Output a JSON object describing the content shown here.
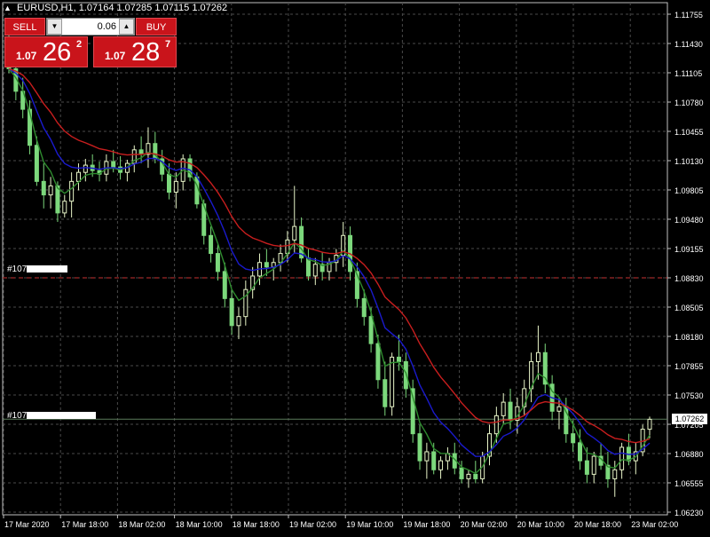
{
  "header": {
    "symbol_tf": "EURUSD,H1",
    "ohlc": "1.07164 1.07285 1.07115 1.07262"
  },
  "trade_panel": {
    "sell_label": "SELL",
    "buy_label": "BUY",
    "lot_value": "0.06",
    "sell_big": "1.07",
    "sell_pips": "26",
    "sell_frac": "2",
    "buy_big": "1.07",
    "buy_pips": "28",
    "buy_frac": "7"
  },
  "order_lines": [
    {
      "label": "#107",
      "price": 1.0883,
      "color": "#c83232",
      "style": "dashed"
    },
    {
      "label": "#107",
      "price": 1.07262,
      "color": "#5a7a5a",
      "style": "solid"
    }
  ],
  "current_price_tag": "1.07262",
  "colors": {
    "bull_candle": "#e8f5c8",
    "bear_candle": "#7cd87c",
    "ma_fast": "#2e8b2e",
    "ma_mid": "#1a1acc",
    "ma_slow": "#c81e1e",
    "grid": "#4a4a4a",
    "accent_red": "#c9141b"
  },
  "chart_data": {
    "type": "candlestick",
    "y_ticks": [
      "1.11755",
      "1.11430",
      "1.11105",
      "1.10780",
      "1.10455",
      "1.10130",
      "1.09805",
      "1.09480",
      "1.09155",
      "1.08830",
      "1.08505",
      "1.08180",
      "1.07855",
      "1.07530",
      "1.07205",
      "1.06880",
      "1.06555",
      "1.06230"
    ],
    "ylim": [
      1.0623,
      1.11755
    ],
    "x_ticks": [
      "17 Mar 2020",
      "17 Mar 18:00",
      "18 Mar 02:00",
      "18 Mar 10:00",
      "18 Mar 18:00",
      "19 Mar 02:00",
      "19 Mar 10:00",
      "19 Mar 18:00",
      "20 Mar 02:00",
      "20 Mar 10:00",
      "20 Mar 18:00",
      "23 Mar 02:00"
    ],
    "candles": [
      [
        1.114,
        1.1165,
        1.111,
        1.1115
      ],
      [
        1.1115,
        1.114,
        1.108,
        1.109
      ],
      [
        1.109,
        1.1105,
        1.106,
        1.107
      ],
      [
        1.107,
        1.108,
        1.102,
        1.103
      ],
      [
        1.103,
        1.104,
        1.0985,
        1.099
      ],
      [
        1.099,
        1.101,
        1.096,
        1.0975
      ],
      [
        1.0975,
        1.0995,
        1.096,
        1.0985
      ],
      [
        1.0985,
        1.099,
        1.0945,
        1.0955
      ],
      [
        1.0955,
        1.0975,
        1.095,
        1.0968
      ],
      [
        1.0968,
        1.1,
        1.095,
        1.099
      ],
      [
        1.099,
        1.101,
        1.098,
        1.1
      ],
      [
        1.1,
        1.1015,
        1.099,
        1.1008
      ],
      [
        1.1008,
        1.102,
        1.0995,
        1.1002
      ],
      [
        1.1002,
        1.1012,
        1.099,
        1.0998
      ],
      [
        1.0998,
        1.102,
        1.099,
        1.1012
      ],
      [
        1.1012,
        1.1025,
        1.1,
        1.1006
      ],
      [
        1.1006,
        1.1018,
        1.0992,
        1.1
      ],
      [
        1.1,
        1.1014,
        1.099,
        1.101
      ],
      [
        1.101,
        1.103,
        1.1,
        1.1025
      ],
      [
        1.1025,
        1.104,
        1.101,
        1.102
      ],
      [
        1.102,
        1.105,
        1.1005,
        1.1032
      ],
      [
        1.1032,
        1.1045,
        1.101,
        1.1015
      ],
      [
        1.1015,
        1.1025,
        1.099,
        1.0998
      ],
      [
        1.0998,
        1.101,
        1.097,
        1.0978
      ],
      [
        1.0978,
        1.1,
        1.096,
        1.099
      ],
      [
        1.099,
        1.102,
        1.098,
        1.1015
      ],
      [
        1.1015,
        1.102,
        1.099,
        1.0995
      ],
      [
        1.0995,
        1.1,
        1.096,
        1.0965
      ],
      [
        1.0965,
        1.097,
        1.092,
        1.093
      ],
      [
        1.093,
        1.094,
        1.09,
        1.091
      ],
      [
        1.091,
        1.092,
        1.088,
        1.089
      ],
      [
        1.089,
        1.09,
        1.085,
        1.086
      ],
      [
        1.086,
        1.087,
        1.082,
        1.083
      ],
      [
        1.083,
        1.085,
        1.0815,
        1.084
      ],
      [
        1.084,
        1.088,
        1.083,
        1.087
      ],
      [
        1.087,
        1.0895,
        1.086,
        1.0885
      ],
      [
        1.0885,
        1.091,
        1.0875,
        1.09
      ],
      [
        1.09,
        1.0915,
        1.0885,
        1.0895
      ],
      [
        1.0895,
        1.0905,
        1.088,
        1.09
      ],
      [
        1.09,
        1.092,
        1.089,
        1.091
      ],
      [
        1.091,
        1.0935,
        1.09,
        1.0925
      ],
      [
        1.0925,
        1.0985,
        1.091,
        1.094
      ],
      [
        1.094,
        1.095,
        1.09,
        1.0905
      ],
      [
        1.0905,
        1.0915,
        1.088,
        1.0885
      ],
      [
        1.0885,
        1.0905,
        1.0875,
        1.0898
      ],
      [
        1.0898,
        1.0912,
        1.088,
        1.089
      ],
      [
        1.089,
        1.0905,
        1.088,
        1.09
      ],
      [
        1.09,
        1.0915,
        1.089,
        1.0908
      ],
      [
        1.0908,
        1.0945,
        1.0895,
        1.093
      ],
      [
        1.093,
        1.094,
        1.088,
        1.089
      ],
      [
        1.089,
        1.09,
        1.085,
        1.086
      ],
      [
        1.086,
        1.087,
        1.083,
        1.084
      ],
      [
        1.084,
        1.085,
        1.08,
        1.081
      ],
      [
        1.081,
        1.082,
        1.076,
        1.077
      ],
      [
        1.077,
        1.079,
        1.073,
        1.074
      ],
      [
        1.074,
        1.08,
        1.073,
        1.0795
      ],
      [
        1.0795,
        1.082,
        1.078,
        1.079
      ],
      [
        1.079,
        1.08,
        1.075,
        1.076
      ],
      [
        1.076,
        1.077,
        1.07,
        1.071
      ],
      [
        1.071,
        1.072,
        1.067,
        1.068
      ],
      [
        1.068,
        1.07,
        1.066,
        1.069
      ],
      [
        1.069,
        1.07,
        1.0665,
        1.067
      ],
      [
        1.067,
        1.0685,
        1.066,
        1.068
      ],
      [
        1.068,
        1.0695,
        1.067,
        1.0688
      ],
      [
        1.0688,
        1.07,
        1.0665,
        1.0672
      ],
      [
        1.0672,
        1.068,
        1.0655,
        1.066
      ],
      [
        1.066,
        1.067,
        1.065,
        1.0665
      ],
      [
        1.0665,
        1.068,
        1.0655,
        1.066
      ],
      [
        1.066,
        1.069,
        1.0655,
        1.0685
      ],
      [
        1.0685,
        1.072,
        1.0675,
        1.071
      ],
      [
        1.071,
        1.074,
        1.07,
        1.073
      ],
      [
        1.073,
        1.0755,
        1.072,
        1.0745
      ],
      [
        1.0745,
        1.076,
        1.0715,
        1.0725
      ],
      [
        1.0725,
        1.075,
        1.071,
        1.074
      ],
      [
        1.074,
        1.077,
        1.073,
        1.076
      ],
      [
        1.076,
        1.08,
        1.0745,
        1.079
      ],
      [
        1.079,
        1.083,
        1.077,
        1.08
      ],
      [
        1.08,
        1.081,
        1.0755,
        1.0765
      ],
      [
        1.0765,
        1.0775,
        1.0725,
        1.0735
      ],
      [
        1.0735,
        1.075,
        1.0715,
        1.074
      ],
      [
        1.074,
        1.075,
        1.07,
        1.071
      ],
      [
        1.071,
        1.0725,
        1.069,
        1.07
      ],
      [
        1.07,
        1.0715,
        1.067,
        1.068
      ],
      [
        1.068,
        1.0695,
        1.0655,
        1.0665
      ],
      [
        1.0665,
        1.069,
        1.0655,
        1.0685
      ],
      [
        1.0685,
        1.07,
        1.067,
        1.0675
      ],
      [
        1.0675,
        1.069,
        1.065,
        1.066
      ],
      [
        1.066,
        1.068,
        1.064,
        1.067
      ],
      [
        1.067,
        1.07,
        1.066,
        1.0695
      ],
      [
        1.0695,
        1.071,
        1.0675,
        1.068
      ],
      [
        1.068,
        1.07,
        1.0665,
        1.069
      ],
      [
        1.069,
        1.072,
        1.0685,
        1.0715
      ],
      [
        1.0715,
        1.0729,
        1.0705,
        1.0726
      ]
    ]
  }
}
